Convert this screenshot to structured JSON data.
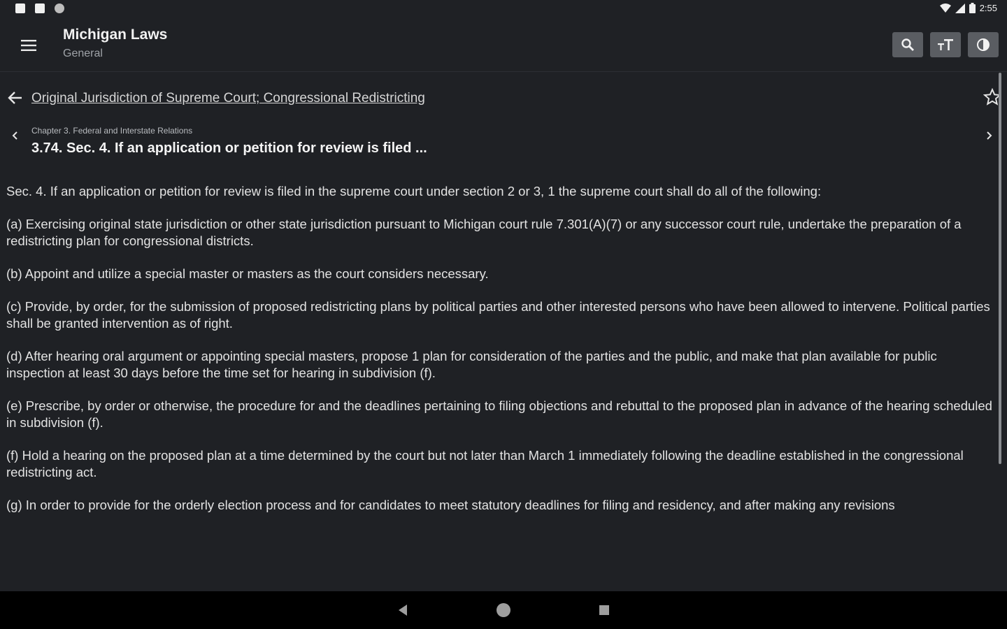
{
  "status_bar": {
    "time": "2:55",
    "notification_icons": [
      "notification-icon",
      "clipboard-icon",
      "circle-icon"
    ],
    "system_icons": [
      "wifi-icon",
      "signal-icon",
      "battery-icon"
    ]
  },
  "app_bar": {
    "title": "Michigan Laws",
    "subtitle": "General",
    "actions": [
      "search-icon",
      "text-size-icon",
      "contrast-icon"
    ]
  },
  "breadcrumb": {
    "link": "Original Jurisdiction of Supreme Court; Congressional Redistricting"
  },
  "section": {
    "chapter": "Chapter 3. Federal and Interstate Relations",
    "title": "3.74. Sec. 4. If an application or petition for review is filed ..."
  },
  "body": {
    "paragraphs": [
      "Sec. 4. If an application or petition for review is filed in the supreme court under section 2 or 3, 1 the supreme court shall do all of the following:",
      "(a) Exercising original state jurisdiction or other state jurisdiction pursuant to Michigan court rule 7.301(A)(7) or any successor court rule, undertake the preparation of a redistricting plan for congressional districts.",
      "(b) Appoint and utilize a special master or masters as the court considers necessary.",
      "(c) Provide, by order, for the submission of proposed redistricting plans by political parties and other interested persons who have been allowed to intervene. Political parties shall be granted intervention as of right.",
      "(d) After hearing oral argument or appointing special masters, propose 1 plan for consideration of the parties and the public, and make that plan available for public inspection at least 30 days before the time set for hearing in subdivision (f).",
      "(e) Prescribe, by order or otherwise, the procedure for and the deadlines pertaining to filing objections and rebuttal to the proposed plan in advance of the hearing scheduled in subdivision (f).",
      "(f) Hold a hearing on the proposed plan at a time determined by the court but not later than March 1 immediately following the deadline established in the congressional redistricting act.",
      "(g) In order to provide for the orderly election process and for candidates to meet statutory deadlines for filing and residency, and after making any revisions"
    ]
  },
  "nav_bar": {
    "buttons": [
      "back-icon",
      "home-icon",
      "recents-icon"
    ]
  },
  "colors": {
    "background": "#1f2125",
    "action_button": "#5a5d62",
    "nav_bar": "#000000"
  }
}
